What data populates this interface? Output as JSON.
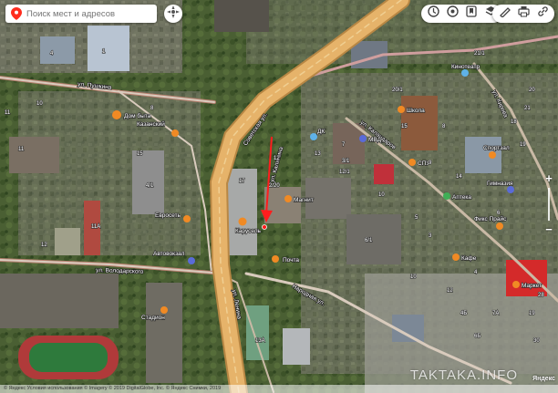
{
  "search": {
    "placeholder": "Поиск мест и адресов"
  },
  "toolbar": {
    "icons": [
      "traffic-icon",
      "layers-icon",
      "bookmark-icon",
      "map-layers-icon",
      "ruler-icon",
      "print-icon",
      "share-icon"
    ]
  },
  "zoom": {
    "plus": "+",
    "minus": "−",
    "level": 0.4
  },
  "streets": [
    "ул. Пушкина",
    "Советская ул.",
    "ул. Калинина",
    "ул. Каландаров",
    "ул. Кирова",
    "ул. Володарского",
    "Народная ул.",
    "ул. Ленина"
  ],
  "places": {
    "dom_byta": "Дом быта",
    "kazan": "Казанский",
    "karusel": "Карусель",
    "magnit": "Магнит",
    "post": "Почта",
    "euroset": "Евросеть",
    "mvd": "МВД",
    "shkola": "Школа",
    "kinoteatr": "Кинотеатр",
    "sportzal": "Спортзал",
    "apteka": "Аптека",
    "fiks_price": "Фикс Прайс",
    "avtovokzal": "Автовокзал",
    "stadion": "Стадион",
    "cafe": "Кафе",
    "dk": "ДК",
    "market": "Маркет",
    "spu": "СПУ",
    "gimnaziya": "Гимназия"
  },
  "house_numbers": [
    "4",
    "1",
    "11",
    "4/1",
    "8",
    "11А",
    "17",
    "12",
    "13",
    "7",
    "12/1",
    "10",
    "15",
    "5",
    "6/1",
    "8",
    "9",
    "14",
    "19",
    "21",
    "20",
    "18",
    "3",
    "4",
    "6",
    "10",
    "12",
    "7А",
    "19",
    "4Б",
    "6Б",
    "28",
    "30",
    "2/20",
    "13А",
    "11",
    "10",
    "12",
    "3/1",
    "20/1",
    "21/1",
    "15"
  ],
  "footer": {
    "text": "© Яндекс  Условия использования   © Imagery © 2019 DigitalGlobe, Inc.   © Яндекс Снимки, 2019"
  },
  "watermark": "TAKTAKA.INFO",
  "brand": "Яндекс",
  "colors": {
    "marker": "#ff1e1e",
    "poi_orange": "#f08a24",
    "road_main": "#e6b36a",
    "road_edge": "#b88744"
  }
}
